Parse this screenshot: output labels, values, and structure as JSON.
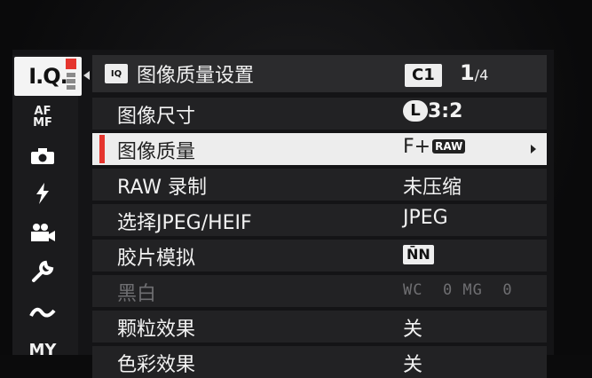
{
  "rail": {
    "active_tab": "I.Q.",
    "tabs": [
      {
        "label": "AF\nMF"
      },
      {
        "label": "camera"
      },
      {
        "label": "flash"
      },
      {
        "label": "movie"
      },
      {
        "label": "wrench"
      },
      {
        "label": "connection"
      },
      {
        "label": "MY"
      }
    ]
  },
  "header": {
    "icon_text": "IQ",
    "title": "图像质量设置",
    "custom_bank": "C1",
    "page_current": "1",
    "page_total": "/4"
  },
  "rows": [
    {
      "label": "图像尺寸",
      "value_prefix": "L",
      "value": "3:2"
    },
    {
      "label": "图像质量",
      "value": "F+",
      "value_badge": "RAW",
      "selected": true
    },
    {
      "label": "RAW 录制",
      "value": "未压缩"
    },
    {
      "label": "选择JPEG/HEIF",
      "value": "JPEG"
    },
    {
      "label": "胶片模拟",
      "value_badge": "N̄N"
    },
    {
      "label": "黑白",
      "value": "WC  0 MG  0",
      "disabled": true
    },
    {
      "label": "颗粒效果",
      "value": "关"
    },
    {
      "label": "色彩效果",
      "value": "关"
    }
  ],
  "colors": {
    "accent": "#e5352e",
    "selected_bg": "#ededed"
  }
}
